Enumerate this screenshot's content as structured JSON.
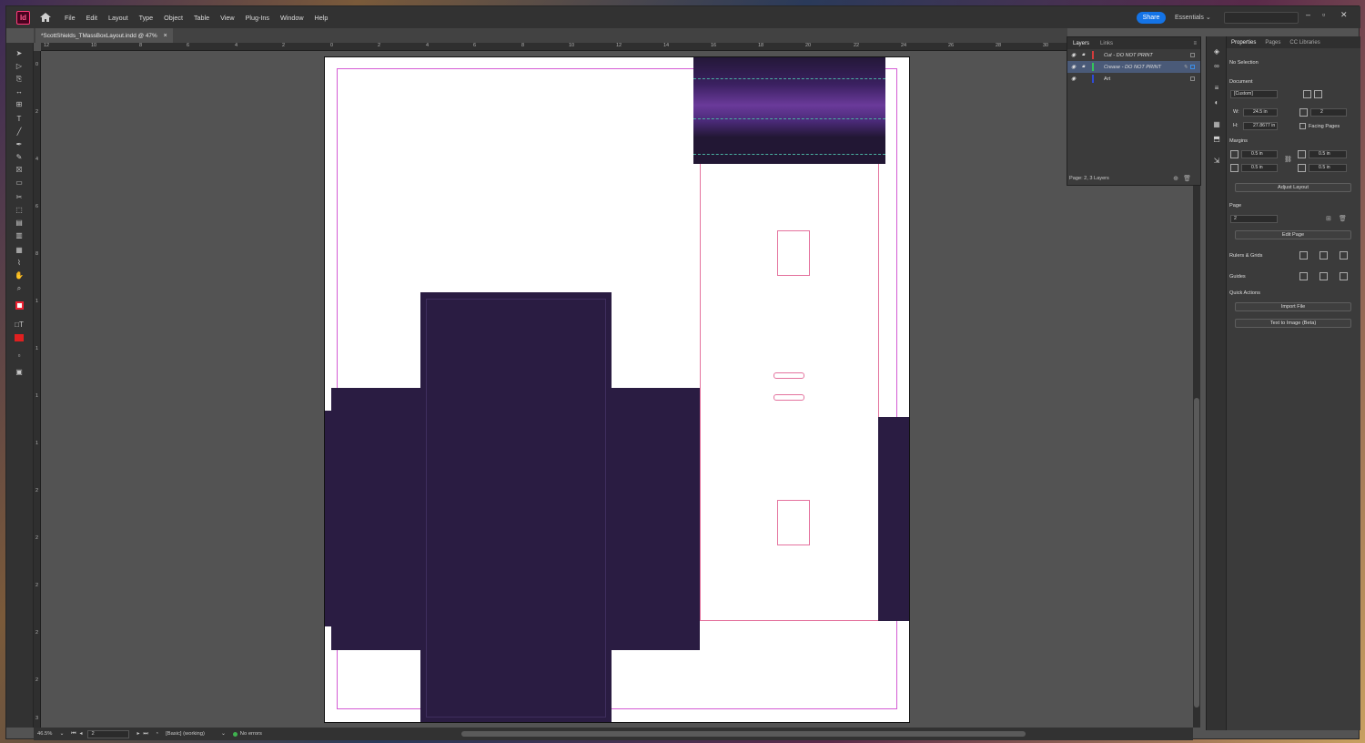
{
  "app": {
    "logo": "Id",
    "menu": [
      "File",
      "Edit",
      "Layout",
      "Type",
      "Object",
      "Table",
      "View",
      "Plug-Ins",
      "Window",
      "Help"
    ],
    "share_label": "Share",
    "workspace": "Essentials",
    "icons": {
      "home": "home-icon",
      "minimize": "minimize-icon",
      "maximize": "maximize-icon",
      "close": "close-icon"
    }
  },
  "document": {
    "tab_title": "*ScottShields_TMassBoxLayout.indd @ 47%"
  },
  "rulers": {
    "top": [
      "12",
      "10",
      "8",
      "6",
      "4",
      "2",
      "0",
      "2",
      "4",
      "6",
      "8",
      "10",
      "12",
      "14",
      "16",
      "18",
      "20",
      "22",
      "24",
      "26",
      "28",
      "30"
    ],
    "left": [
      "0",
      "2",
      "4",
      "6",
      "8",
      "1",
      "1",
      "1",
      "1",
      "2",
      "2",
      "2",
      "2",
      "2",
      "3"
    ]
  },
  "status": {
    "zoom": "46.5%",
    "page": "2",
    "preflight_profile": "[Basic] (working)",
    "errors": "No errors"
  },
  "layers": {
    "tabs": [
      "Layers",
      "Links"
    ],
    "rows": [
      {
        "name": "Cut - DO NOT PRINT",
        "color": "#d33c3c"
      },
      {
        "name": "Crease - DO NOT PRINT",
        "color": "#34c55a"
      },
      {
        "name": "Art",
        "color": "#2f4bd8"
      }
    ],
    "footer": "Page: 2, 3 Layers"
  },
  "properties": {
    "tabs": [
      "Properties",
      "Pages",
      "CC Libraries"
    ],
    "selection": "No Selection",
    "document_label": "Document",
    "preset": "[Custom]",
    "width": "24.5 in",
    "height": "27.8677 in",
    "pages": "2",
    "facing_pages": "Facing Pages",
    "margins_label": "Margins",
    "margin_top": "0.5 in",
    "margin_bottom": "0.5 in",
    "margin_left": "0.5 in",
    "margin_right": "0.5 in",
    "adjust_layout": "Adjust Layout",
    "page_label": "Page",
    "page_value": "2",
    "edit_page": "Edit Page",
    "rulers_grids": "Rulers & Grids",
    "guides": "Guides",
    "quick_actions": "Quick Actions",
    "import_file": "Import File",
    "text_to_image": "Text to Image (Beta)"
  }
}
